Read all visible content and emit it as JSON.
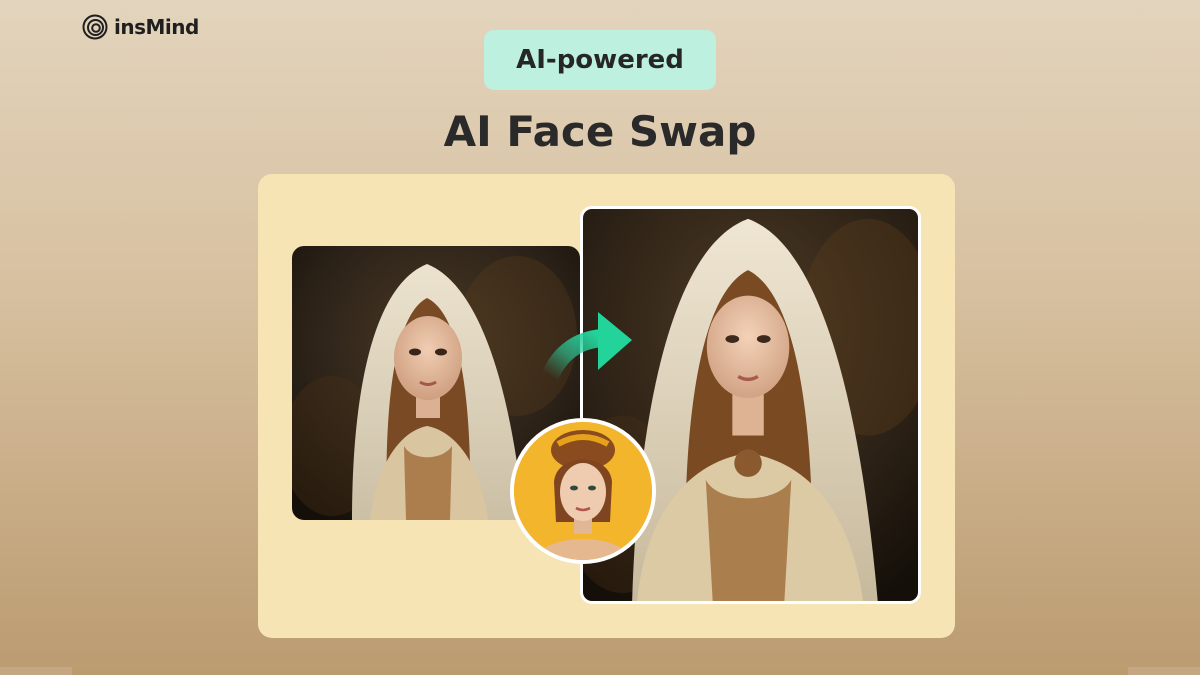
{
  "brand": {
    "name": "insMind",
    "logo_icon": "concentric-circles-icon"
  },
  "badge": {
    "label": "AI-powered",
    "background": "#bdf0df"
  },
  "headline": {
    "title": "AI Face Swap"
  },
  "card": {
    "background": "#f7e4b4",
    "original_image": "veiled-girl-portrait",
    "source_face_image": "woman-yellow-background",
    "result_image": "face-swapped-portrait",
    "arrow_icon": "green-curved-arrow-icon",
    "arrow_color": "#2cd0a0"
  }
}
